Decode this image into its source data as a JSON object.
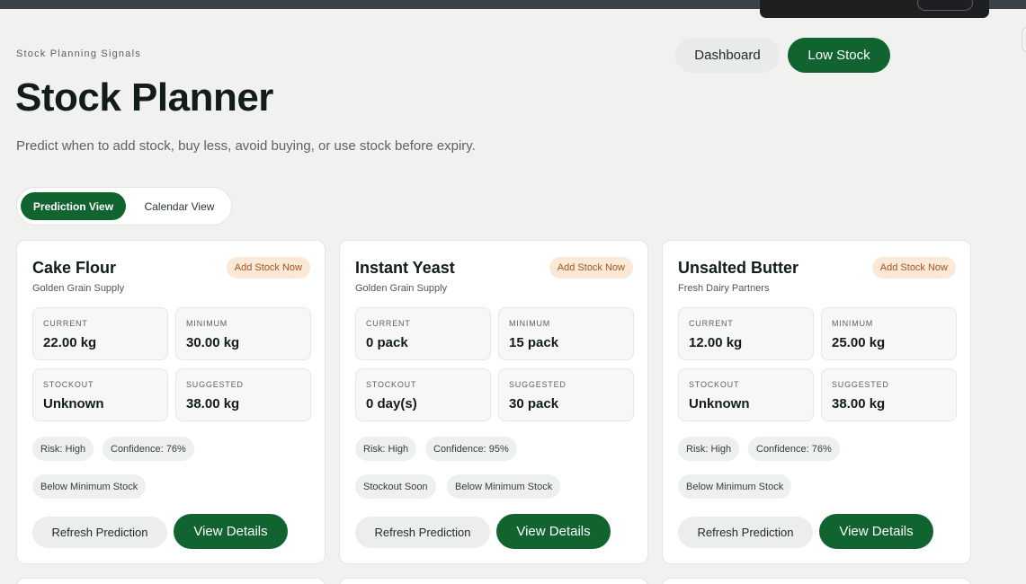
{
  "header": {
    "eyebrow": "Stock Planning Signals",
    "title": "Stock Planner",
    "subtitle": "Predict when to add stock, buy less, avoid buying, or use stock before expiry."
  },
  "nav": {
    "dashboard_label": "Dashboard",
    "low_stock_label": "Low Stock"
  },
  "view_toggle": {
    "prediction_label": "Prediction View",
    "calendar_label": "Calendar View",
    "active": "Prediction View"
  },
  "colors": {
    "primary": "#11632f",
    "badge_bg": "#fbe9d8",
    "badge_text": "#a4531a"
  },
  "cards": [
    {
      "name": "Cake Flour",
      "supplier": "Golden Grain Supply",
      "badge": "Add Stock Now",
      "current_label": "CURRENT",
      "current_value": "22.00 kg",
      "minimum_label": "MINIMUM",
      "minimum_value": "30.00 kg",
      "stockout_label": "STOCKOUT",
      "stockout_value": "Unknown",
      "suggested_label": "SUGGESTED",
      "suggested_value": "38.00 kg",
      "risk": "Risk: High",
      "confidence": "Confidence: 76%",
      "tag_a": "Below Minimum Stock",
      "tag_b": "",
      "refresh_label": "Refresh Prediction",
      "view_label": "View Details"
    },
    {
      "name": "Instant Yeast",
      "supplier": "Golden Grain Supply",
      "badge": "Add Stock Now",
      "current_label": "CURRENT",
      "current_value": "0 pack",
      "minimum_label": "MINIMUM",
      "minimum_value": "15 pack",
      "stockout_label": "STOCKOUT",
      "stockout_value": "0 day(s)",
      "suggested_label": "SUGGESTED",
      "suggested_value": "30 pack",
      "risk": "Risk: High",
      "confidence": "Confidence: 95%",
      "tag_a": "Stockout Soon",
      "tag_b": "Below Minimum Stock",
      "refresh_label": "Refresh Prediction",
      "view_label": "View Details"
    },
    {
      "name": "Unsalted Butter",
      "supplier": "Fresh Dairy Partners",
      "badge": "Add Stock Now",
      "current_label": "CURRENT",
      "current_value": "12.00 kg",
      "minimum_label": "MINIMUM",
      "minimum_value": "25.00 kg",
      "stockout_label": "STOCKOUT",
      "stockout_value": "Unknown",
      "suggested_label": "SUGGESTED",
      "suggested_value": "38.00 kg",
      "risk": "Risk: High",
      "confidence": "Confidence: 76%",
      "tag_a": "Below Minimum Stock",
      "tag_b": "",
      "refresh_label": "Refresh Prediction",
      "view_label": "View Details"
    }
  ]
}
